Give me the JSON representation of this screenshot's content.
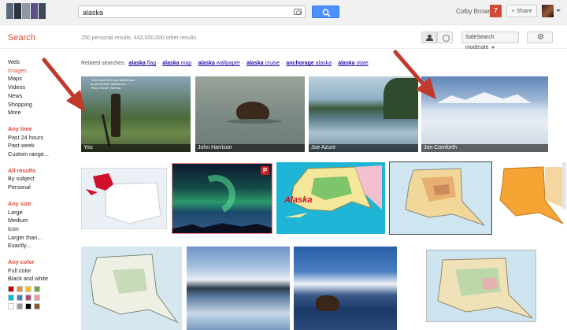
{
  "header": {
    "query": "alaska",
    "user_name": "Colby Brown",
    "notification_count": "7",
    "share_label": "+ Share"
  },
  "subheader": {
    "section_title": "Search",
    "results_count": "250 personal results. 442,000,000 other results.",
    "safesearch_label": "SafeSearch moderate"
  },
  "sidebar": {
    "nav": [
      "Web",
      "Images",
      "Maps",
      "Videos",
      "News",
      "Shopping",
      "More"
    ],
    "active": "Images",
    "time": {
      "title": "Any time",
      "items": [
        "Past 24 hours",
        "Past week",
        "Custom range..."
      ]
    },
    "results": {
      "title": "All results",
      "items": [
        "By subject",
        "Personal"
      ]
    },
    "size": {
      "title": "Any size",
      "items": [
        "Large",
        "Medium",
        "Icon",
        "Larger than...",
        "Exactly..."
      ]
    },
    "color": {
      "title": "Any color",
      "items": [
        "Full color",
        "Black and white"
      ]
    },
    "swatch_colors": [
      "#cc0000",
      "#e69138",
      "#f1c232",
      "#6aa84f",
      "#00bcd4",
      "#3d85c6",
      "#a64d79",
      "#ea9999",
      "#ffffff",
      "#999999",
      "#000000",
      "#8b5a2b"
    ]
  },
  "related": {
    "prefix": "Related searches:",
    "items": [
      {
        "bold": "alaska",
        "rest": "flag"
      },
      {
        "bold": "alaska",
        "rest": "map"
      },
      {
        "bold": "alaska",
        "rest": "wallpaper"
      },
      {
        "bold": "alaska",
        "rest": "cruise"
      },
      {
        "bold": "anchorage",
        "rest": "alaska"
      },
      {
        "bold": "alaska",
        "rest": "state"
      }
    ]
  },
  "images": {
    "row1": [
      {
        "caption": "You",
        "quote": "\"Our travel from one wilderness to yet another wilderness...\" - Henry David Thoreau"
      },
      {
        "caption": "John Harrison"
      },
      {
        "caption": "Joe Azure"
      },
      {
        "caption": "Jon Comforth"
      }
    ],
    "map_label": "Alaska",
    "pinterest_icon": "P"
  },
  "colors": {
    "accent_red": "#dd4b39",
    "link_blue": "#1a0dab",
    "button_blue": "#4d90fe",
    "arrow_red": "#c0392b"
  }
}
